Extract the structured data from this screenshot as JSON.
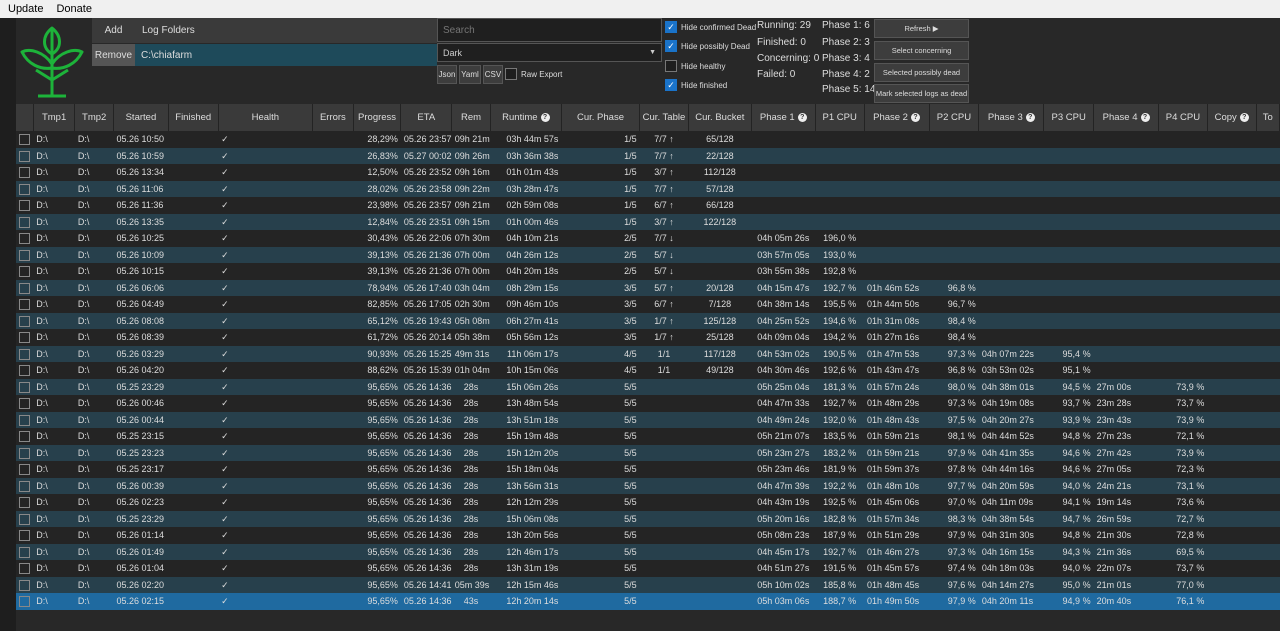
{
  "menu": {
    "update": "Update",
    "donate": "Donate"
  },
  "controls": {
    "add_label": "Add",
    "log_folders_label": "Log Folders",
    "remove_label": "Remove",
    "folder_path": "C:\\chiafarm",
    "search_placeholder": "Search",
    "theme_value": "Dark",
    "json_label": "Json",
    "yaml_label": "Yaml",
    "csv_label": "CSV",
    "raw_export_label": "Raw Export",
    "hide_confirmed_dead": "Hide confirmed Dead",
    "hide_possibly_dead": "Hide possibly Dead",
    "hide_healthy": "Hide healthy",
    "hide_finished": "Hide finished"
  },
  "checkbox_states": {
    "raw_export": false,
    "hide_confirmed_dead": true,
    "hide_possibly_dead": true,
    "hide_healthy": false,
    "hide_finished": true
  },
  "stats": {
    "running": "Running: 29",
    "finished": "Finished: 0",
    "concerning": "Concerning: 0",
    "failed": "Failed: 0",
    "phase1": "Phase 1: 6",
    "phase2": "Phase 2: 3",
    "phase3": "Phase 3: 4",
    "phase4": "Phase 4: 2",
    "phase5": "Phase 5: 14"
  },
  "actions": {
    "refresh": "Refresh ▶",
    "select_concerning": "Select concerning",
    "selected_possibly_dead": "Selected possibly dead",
    "mark_dead": "Mark selected logs as dead"
  },
  "table": {
    "columns": [
      "",
      "Tmp1",
      "Tmp2",
      "Started",
      "Finished",
      "Health",
      "Errors",
      "Progress",
      "ETA",
      "Rem",
      "Runtime",
      "Cur. Phase",
      "Cur. Table",
      "Cur. Bucket",
      "Phase 1",
      "P1 CPU",
      "Phase 2",
      "P2 CPU",
      "Phase 3",
      "P3 CPU",
      "Phase 4",
      "P4 CPU",
      "Copy",
      "To"
    ],
    "info_columns": [
      10,
      14,
      16,
      18,
      20,
      22
    ],
    "rows": [
      [
        "D:\\",
        "D:\\",
        "05.26 10:50",
        "28,29%",
        "05.26 23:57",
        "09h 21m",
        "03h 44m 57s",
        "1/5",
        "7/7 ↑",
        "65/128",
        "",
        "",
        "",
        "",
        "",
        "",
        "",
        "",
        ""
      ],
      [
        "D:\\",
        "D:\\",
        "05.26 10:59",
        "26,83%",
        "05.27 00:02",
        "09h 26m",
        "03h 36m 38s",
        "1/5",
        "7/7 ↑",
        "22/128",
        "",
        "",
        "",
        "",
        "",
        "",
        "",
        "",
        ""
      ],
      [
        "D:\\",
        "D:\\",
        "05.26 13:34",
        "12,50%",
        "05.26 23:52",
        "09h 16m",
        "01h 01m 43s",
        "1/5",
        "3/7 ↑",
        "112/128",
        "",
        "",
        "",
        "",
        "",
        "",
        "",
        "",
        ""
      ],
      [
        "D:\\",
        "D:\\",
        "05.26 11:06",
        "28,02%",
        "05.26 23:58",
        "09h 22m",
        "03h 28m 47s",
        "1/5",
        "7/7 ↑",
        "57/128",
        "",
        "",
        "",
        "",
        "",
        "",
        "",
        "",
        ""
      ],
      [
        "D:\\",
        "D:\\",
        "05.26 11:36",
        "23,98%",
        "05.26 23:57",
        "09h 21m",
        "02h 59m 08s",
        "1/5",
        "6/7 ↑",
        "66/128",
        "",
        "",
        "",
        "",
        "",
        "",
        "",
        "",
        ""
      ],
      [
        "D:\\",
        "D:\\",
        "05.26 13:35",
        "12,84%",
        "05.26 23:51",
        "09h 15m",
        "01h 00m 46s",
        "1/5",
        "3/7 ↑",
        "122/128",
        "",
        "",
        "",
        "",
        "",
        "",
        "",
        "",
        ""
      ],
      [
        "D:\\",
        "D:\\",
        "05.26 10:25",
        "30,43%",
        "05.26 22:06",
        "07h 30m",
        "04h 10m 21s",
        "2/5",
        "7/7 ↓",
        "",
        "04h 05m 26s",
        "196,0 %",
        "",
        "",
        "",
        "",
        "",
        "",
        ""
      ],
      [
        "D:\\",
        "D:\\",
        "05.26 10:09",
        "39,13%",
        "05.26 21:36",
        "07h 00m",
        "04h 26m 12s",
        "2/5",
        "5/7 ↓",
        "",
        "03h 57m 05s",
        "193,0 %",
        "",
        "",
        "",
        "",
        "",
        "",
        ""
      ],
      [
        "D:\\",
        "D:\\",
        "05.26 10:15",
        "39,13%",
        "05.26 21:36",
        "07h 00m",
        "04h 20m 18s",
        "2/5",
        "5/7 ↓",
        "",
        "03h 55m 38s",
        "192,8 %",
        "",
        "",
        "",
        "",
        "",
        "",
        ""
      ],
      [
        "D:\\",
        "D:\\",
        "05.26 06:06",
        "78,94%",
        "05.26 17:40",
        "03h 04m",
        "08h 29m 15s",
        "3/5",
        "5/7 ↑",
        "20/128",
        "04h 15m 47s",
        "192,7 %",
        "01h 46m 52s",
        "96,8 %",
        "",
        "",
        "",
        "",
        ""
      ],
      [
        "D:\\",
        "D:\\",
        "05.26 04:49",
        "82,85%",
        "05.26 17:05",
        "02h 30m",
        "09h 46m 10s",
        "3/5",
        "6/7 ↑",
        "7/128",
        "04h 38m 14s",
        "195,5 %",
        "01h 44m 50s",
        "96,7 %",
        "",
        "",
        "",
        "",
        ""
      ],
      [
        "D:\\",
        "D:\\",
        "05.26 08:08",
        "65,12%",
        "05.26 19:43",
        "05h 08m",
        "06h 27m 41s",
        "3/5",
        "1/7 ↑",
        "125/128",
        "04h 25m 52s",
        "194,6 %",
        "01h 31m 08s",
        "98,4 %",
        "",
        "",
        "",
        "",
        ""
      ],
      [
        "D:\\",
        "D:\\",
        "05.26 08:39",
        "61,72%",
        "05.26 20:14",
        "05h 38m",
        "05h 56m 12s",
        "3/5",
        "1/7 ↑",
        "25/128",
        "04h 09m 04s",
        "194,2 %",
        "01h 27m 16s",
        "98,4 %",
        "",
        "",
        "",
        "",
        ""
      ],
      [
        "D:\\",
        "D:\\",
        "05.26 03:29",
        "90,93%",
        "05.26 15:25",
        "49m 31s",
        "11h 06m 17s",
        "4/5",
        "1/1",
        "117/128",
        "04h 53m 02s",
        "190,5 %",
        "01h 47m 53s",
        "97,3 %",
        "04h 07m 22s",
        "95,4 %",
        "",
        "",
        ""
      ],
      [
        "D:\\",
        "D:\\",
        "05.26 04:20",
        "88,62%",
        "05.26 15:39",
        "01h 04m",
        "10h 15m 06s",
        "4/5",
        "1/1",
        "49/128",
        "04h 30m 46s",
        "192,6 %",
        "01h 43m 47s",
        "96,8 %",
        "03h 53m 02s",
        "95,1 %",
        "",
        "",
        ""
      ],
      [
        "D:\\",
        "D:\\",
        "05.25 23:29",
        "95,65%",
        "05.26 14:36",
        "28s",
        "15h 06m 26s",
        "5/5",
        "",
        "",
        "05h 25m 04s",
        "181,3 %",
        "01h 57m 24s",
        "98,0 %",
        "04h 38m 01s",
        "94,5 %",
        "27m 00s",
        "73,9 %",
        ""
      ],
      [
        "D:\\",
        "D:\\",
        "05.26 00:46",
        "95,65%",
        "05.26 14:36",
        "28s",
        "13h 48m 54s",
        "5/5",
        "",
        "",
        "04h 47m 33s",
        "192,7 %",
        "01h 48m 29s",
        "97,3 %",
        "04h 19m 08s",
        "93,7 %",
        "23m 28s",
        "73,7 %",
        ""
      ],
      [
        "D:\\",
        "D:\\",
        "05.26 00:44",
        "95,65%",
        "05.26 14:36",
        "28s",
        "13h 51m 18s",
        "5/5",
        "",
        "",
        "04h 49m 24s",
        "192,0 %",
        "01h 48m 43s",
        "97,5 %",
        "04h 20m 27s",
        "93,9 %",
        "23m 43s",
        "73,9 %",
        ""
      ],
      [
        "D:\\",
        "D:\\",
        "05.25 23:15",
        "95,65%",
        "05.26 14:36",
        "28s",
        "15h 19m 48s",
        "5/5",
        "",
        "",
        "05h 21m 07s",
        "183,5 %",
        "01h 59m 21s",
        "98,1 %",
        "04h 44m 52s",
        "94,8 %",
        "27m 23s",
        "72,1 %",
        ""
      ],
      [
        "D:\\",
        "D:\\",
        "05.25 23:23",
        "95,65%",
        "05.26 14:36",
        "28s",
        "15h 12m 20s",
        "5/5",
        "",
        "",
        "05h 23m 27s",
        "183,2 %",
        "01h 59m 21s",
        "97,9 %",
        "04h 41m 35s",
        "94,6 %",
        "27m 42s",
        "73,9 %",
        ""
      ],
      [
        "D:\\",
        "D:\\",
        "05.25 23:17",
        "95,65%",
        "05.26 14:36",
        "28s",
        "15h 18m 04s",
        "5/5",
        "",
        "",
        "05h 23m 46s",
        "181,9 %",
        "01h 59m 37s",
        "97,8 %",
        "04h 44m 16s",
        "94,6 %",
        "27m 05s",
        "72,3 %",
        ""
      ],
      [
        "D:\\",
        "D:\\",
        "05.26 00:39",
        "95,65%",
        "05.26 14:36",
        "28s",
        "13h 56m 31s",
        "5/5",
        "",
        "",
        "04h 47m 39s",
        "192,2 %",
        "01h 48m 10s",
        "97,7 %",
        "04h 20m 59s",
        "94,0 %",
        "24m 21s",
        "73,1 %",
        ""
      ],
      [
        "D:\\",
        "D:\\",
        "05.26 02:23",
        "95,65%",
        "05.26 14:36",
        "28s",
        "12h 12m 29s",
        "5/5",
        "",
        "",
        "04h 43m 19s",
        "192,5 %",
        "01h 45m 06s",
        "97,0 %",
        "04h 11m 09s",
        "94,1 %",
        "19m 14s",
        "73,6 %",
        ""
      ],
      [
        "D:\\",
        "D:\\",
        "05.25 23:29",
        "95,65%",
        "05.26 14:36",
        "28s",
        "15h 06m 08s",
        "5/5",
        "",
        "",
        "05h 20m 16s",
        "182,8 %",
        "01h 57m 34s",
        "98,3 %",
        "04h 38m 54s",
        "94,7 %",
        "26m 59s",
        "72,7 %",
        ""
      ],
      [
        "D:\\",
        "D:\\",
        "05.26 01:14",
        "95,65%",
        "05.26 14:36",
        "28s",
        "13h 20m 56s",
        "5/5",
        "",
        "",
        "05h 08m 23s",
        "187,9 %",
        "01h 51m 29s",
        "97,9 %",
        "04h 31m 30s",
        "94,8 %",
        "21m 30s",
        "72,8 %",
        ""
      ],
      [
        "D:\\",
        "D:\\",
        "05.26 01:49",
        "95,65%",
        "05.26 14:36",
        "28s",
        "12h 46m 17s",
        "5/5",
        "",
        "",
        "04h 45m 17s",
        "192,7 %",
        "01h 46m 27s",
        "97,3 %",
        "04h 16m 15s",
        "94,3 %",
        "21m 36s",
        "69,5 %",
        ""
      ],
      [
        "D:\\",
        "D:\\",
        "05.26 01:04",
        "95,65%",
        "05.26 14:36",
        "28s",
        "13h 31m 19s",
        "5/5",
        "",
        "",
        "04h 51m 27s",
        "191,5 %",
        "01h 45m 57s",
        "97,4 %",
        "04h 18m 03s",
        "94,0 %",
        "22m 07s",
        "73,7 %",
        ""
      ],
      [
        "D:\\",
        "D:\\",
        "05.26 02:20",
        "95,65%",
        "05.26 14:41",
        "05m 39s",
        "12h 15m 46s",
        "5/5",
        "",
        "",
        "05h 10m 02s",
        "185,8 %",
        "01h 48m 45s",
        "97,6 %",
        "04h 14m 27s",
        "95,0 %",
        "21m 01s",
        "77,0 %",
        ""
      ],
      [
        "D:\\",
        "D:\\",
        "05.26 02:15",
        "95,65%",
        "05.26 14:36",
        "43s",
        "12h 20m 14s",
        "5/5",
        "",
        "",
        "05h 03m 06s",
        "188,7 %",
        "01h 49m 50s",
        "97,9 %",
        "04h 20m 11s",
        "94,9 %",
        "20m 40s",
        "76,1 %",
        ""
      ]
    ],
    "health_mark": "✓",
    "selected_row": 28
  },
  "colors": {
    "accent": "#1a73c9",
    "logo_green": "#1db33a",
    "row_alt": "#27404c",
    "row_selected": "#1f6aa0"
  }
}
